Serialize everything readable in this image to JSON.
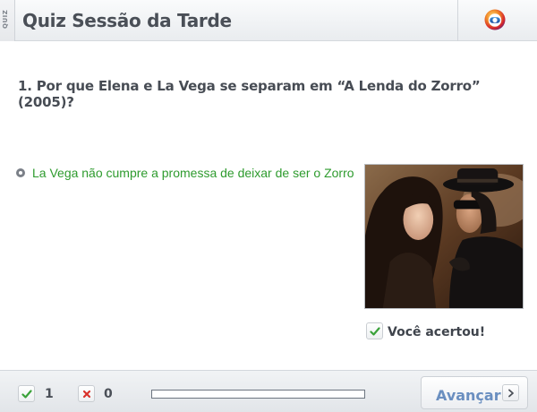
{
  "header": {
    "side_tab_label": "QUIZ",
    "title": "Quiz Sessão da Tarde",
    "logo_icon": "globo-logo-icon"
  },
  "question": {
    "text": "1. Por que Elena e La Vega se separam em “A Lenda do Zorro” (2005)?"
  },
  "answer": {
    "text": "La Vega não cumpre a promessa de deixar de ser o Zorro",
    "color": "#2e9b2e"
  },
  "result": {
    "icon": "check-icon",
    "text": "Você acertou!"
  },
  "footer": {
    "correct_icon": "check-icon",
    "correct_count": "1",
    "wrong_icon": "x-icon",
    "wrong_count": "0",
    "progress": 0.0,
    "next_label": "Avançar",
    "next_icon": "chevron-right-icon"
  },
  "colors": {
    "accent": "#6a8fc0",
    "correct": "#2e9b2e",
    "wrong": "#d9322b"
  }
}
